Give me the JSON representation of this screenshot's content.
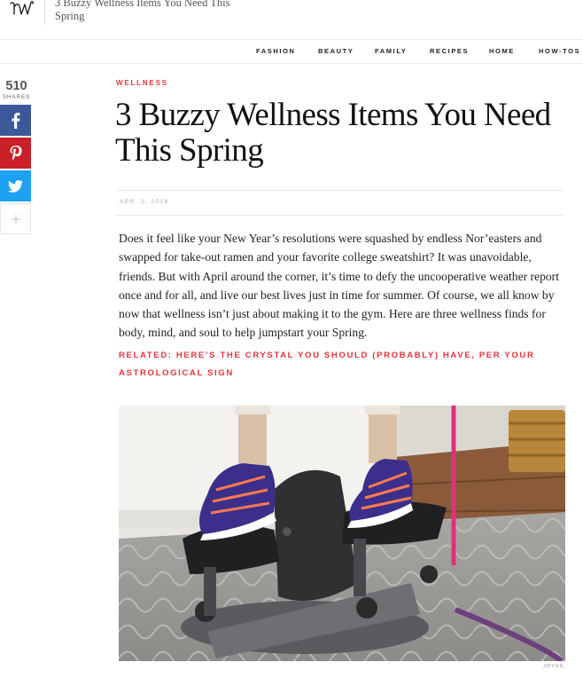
{
  "site": {
    "top_title": "3 Buzzy Wellness Items You Need This Spring"
  },
  "nav": {
    "items": [
      "FASHION",
      "BEAUTY",
      "FAMILY",
      "RECIPES",
      "HOME",
      "HOW-TOS"
    ]
  },
  "share": {
    "count": "510",
    "label": "SHARES",
    "buttons": [
      {
        "icon": "facebook-icon",
        "color": "#3b5998"
      },
      {
        "icon": "pinterest-icon",
        "color": "#cb2027"
      },
      {
        "icon": "twitter-icon",
        "color": "#1da1f2"
      },
      {
        "icon": "plus-icon",
        "color": "#cccccc"
      }
    ]
  },
  "article": {
    "category": "WELLNESS",
    "title": "3 Buzzy Wellness Items You Need This Spring",
    "date": "APR. 2, 2018",
    "body": "Does it feel like your New Year’s resolutions were squashed by endless Nor’easters and swapped for take-out ramen and your favorite college sweatshirt? It was unavoidable, friends. But with April around the corner, it’s time to defy the uncooperative weather report once and for all, and live our best lives just in time for summer. Of course, we all know by now that wellness isn’t just about making it to the gym. Here are three wellness finds for body, mind, and soul to help jumpstart your Spring.",
    "related_prefix": "RELATED:",
    "related_text": "HERE’S THE CRYSTAL YOU SHOULD (PROBABLY) HAVE, PER YOUR ASTROLOGICAL SIGN",
    "image_credit": "JOYUS"
  },
  "colors": {
    "accent": "#e8333b",
    "facebook": "#3b5998",
    "pinterest": "#cb2027",
    "twitter": "#1da1f2"
  }
}
